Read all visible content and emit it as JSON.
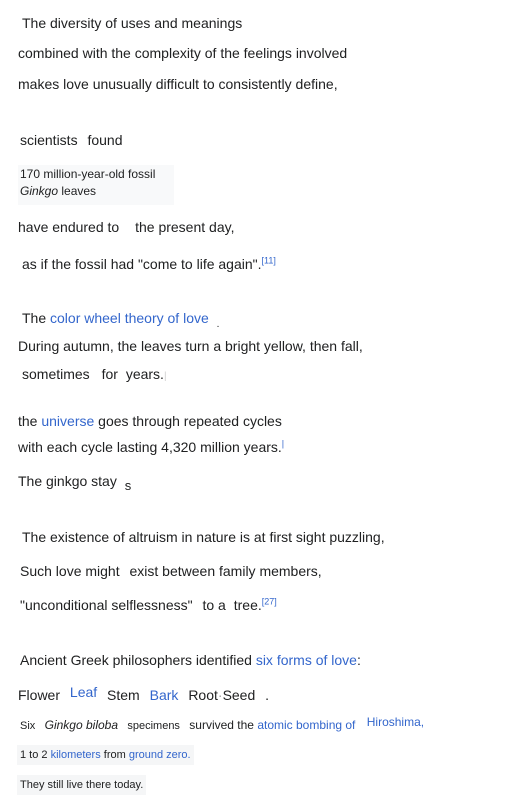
{
  "p1": {
    "l1": "The  diversity of uses and meanings",
    "l2": "combined with the complexity of the feelings involved",
    "l3": "makes love unusually difficult to consistently define,"
  },
  "p2": {
    "scientists": "scientists",
    "found": "found",
    "box_l1": "170 million-year-old fossil",
    "box_l2_italic": "Ginkgo",
    "box_l2_rest": " leaves",
    "have_endured": "have endured to",
    "present_day": "the present day,",
    "as_if": "as if the fossil had \"come to life again\".",
    "ref11": "[11]"
  },
  "p3": {
    "the": "The",
    "color_wheel_link": "color wheel theory of love",
    "period": ".",
    "autumn": "During autumn, the leaves turn a bright yellow, then fall,",
    "sometimes": "sometimes",
    "for": "for",
    "years": "years.",
    "tick": "|"
  },
  "p4": {
    "the": "the",
    "universe_link": "universe",
    "goes": "goes through repeated cycles",
    "cycle": "with each cycle lasting 4,320 million years.",
    "ref_stub": "|",
    "ginkgo_stay": "The ginkgo stay",
    "s": "s"
  },
  "p5": {
    "altruism": "The existence of altruism in nature is at first sight puzzling,",
    "such_love": "Such love might",
    "exist": "exist between family members,",
    "unconditional": "\"unconditional selflessness\"",
    "to_a": "to a",
    "tree": "tree.",
    "ref27": "[27]"
  },
  "p6": {
    "ancient": "Ancient Greek philosophers identified",
    "six_forms_link": "six forms of love",
    "colon": ":",
    "flower": "Flower",
    "leaf_link": "Leaf",
    "stem": "Stem",
    "bark_link": "Bark",
    "root": "Root",
    "dot": "·",
    "seed": "Seed",
    "period": ".",
    "six": "Six",
    "ginkgo_biloba": "Ginkgo biloba",
    "specimens": "specimens",
    "survived": "survived the",
    "atomic_link": "atomic bombing of",
    "hiroshima_link": "Hiroshima,",
    "one_to_two": "1 to 2",
    "kilometers_link": "kilometers",
    "from": "from",
    "ground_zero_link": "ground zero.",
    "still_live": "They still live there today."
  }
}
